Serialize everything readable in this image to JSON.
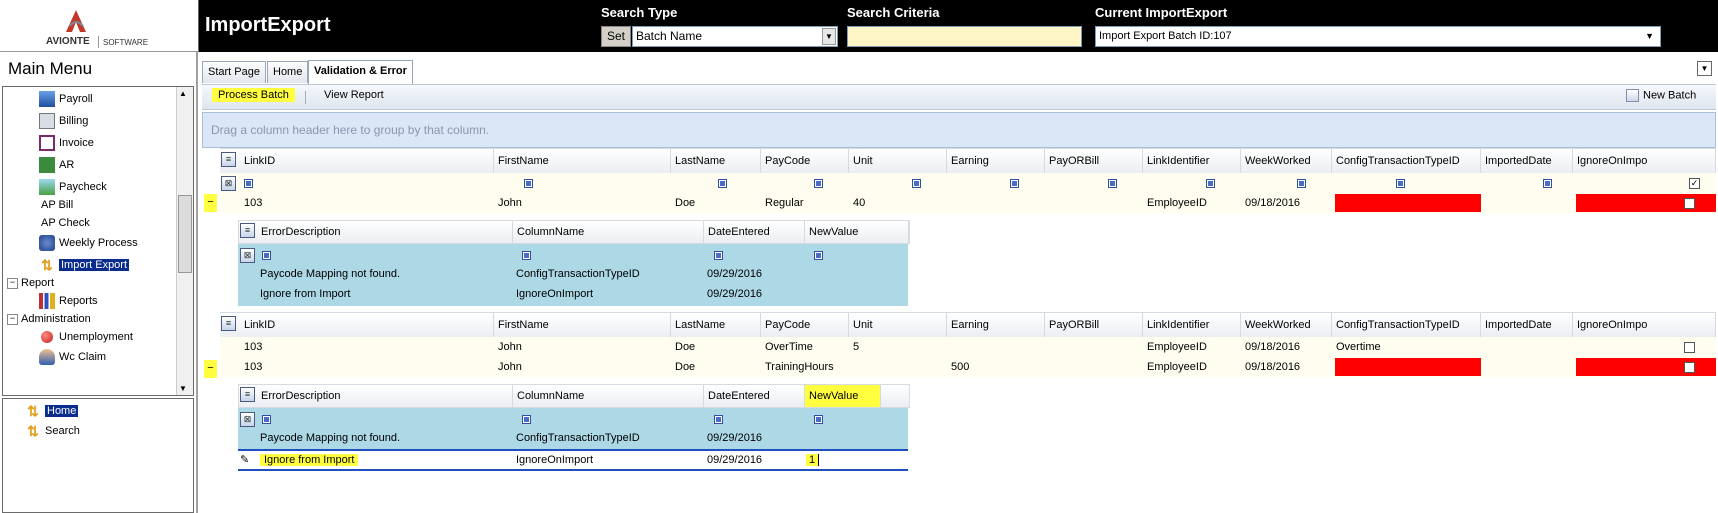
{
  "logo": {
    "brand": "AVIONTE",
    "sub": "SOFTWARE"
  },
  "app_title": "ImportExport",
  "search": {
    "type_label": "Search Type",
    "set_label": "Set",
    "type_value": "Batch Name",
    "criteria_label": "Search Criteria",
    "criteria_value": "",
    "current_label": "Current ImportExport",
    "current_value": "Import Export Batch ID:107"
  },
  "main_menu": {
    "title": "Main Menu",
    "items": [
      {
        "label": "Payroll",
        "icon": "grid-icon"
      },
      {
        "label": "Billing",
        "icon": "list-icon"
      },
      {
        "label": "Invoice",
        "icon": "invoice-icon"
      },
      {
        "label": "AR",
        "icon": "money-icon"
      },
      {
        "label": "Paycheck",
        "icon": "check-icon"
      },
      {
        "label": "AP Bill",
        "icon": ""
      },
      {
        "label": "AP Check",
        "icon": ""
      },
      {
        "label": "Weekly Process",
        "icon": "people-icon"
      },
      {
        "label": "Import Export",
        "icon": "arrows-icon"
      },
      {
        "label": "Report",
        "icon": ""
      },
      {
        "label": "Reports",
        "icon": "chart-icon"
      },
      {
        "label": "Administration",
        "icon": ""
      },
      {
        "label": "Unemployment",
        "icon": "red-dot-icon"
      },
      {
        "label": "Wc Claim",
        "icon": "person-icon"
      }
    ]
  },
  "nav_tree": {
    "home": "Home",
    "search": "Search"
  },
  "tabs": [
    "Start Page",
    "Home",
    "Validation & Error"
  ],
  "toolbar": {
    "process_batch": "Process Batch",
    "view_report": "View Report",
    "new_batch": "New Batch"
  },
  "group_hint": "Drag a column header here to group by that column.",
  "columns": [
    "LinkID",
    "FirstName",
    "LastName",
    "PayCode",
    "Unit",
    "Earning",
    "PayORBill",
    "LinkIdentifier",
    "WeekWorked",
    "ConfigTransactionTypeID",
    "ImportedDate",
    "IgnoreOnImpo"
  ],
  "child_columns": [
    "ErrorDescription",
    "ColumnName",
    "DateEntered",
    "NewValue"
  ],
  "group1": {
    "expander": "−",
    "rows": [
      {
        "LinkID": "103",
        "FirstName": "John",
        "LastName": "Doe",
        "PayCode": "Regular",
        "Unit": "40",
        "Earning": "",
        "PayORBill": "",
        "LinkIdentifier": "EmployeeID",
        "WeekWorked": "09/18/2016",
        "ConfigTransactionTypeID": "",
        "ImportedDate": ""
      }
    ],
    "errors": [
      {
        "ErrorDescription": "Paycode Mapping not found.",
        "ColumnName": "ConfigTransactionTypeID",
        "DateEntered": "09/29/2016",
        "NewValue": ""
      },
      {
        "ErrorDescription": "Ignore from Import",
        "ColumnName": "IgnoreOnImport",
        "DateEntered": "09/29/2016",
        "NewValue": ""
      }
    ]
  },
  "group2": {
    "expander": "−",
    "rows": [
      {
        "LinkID": "103",
        "FirstName": "John",
        "LastName": "Doe",
        "PayCode": "OverTime",
        "Unit": "5",
        "Earning": "",
        "PayORBill": "",
        "LinkIdentifier": "EmployeeID",
        "WeekWorked": "09/18/2016",
        "ConfigTransactionTypeID": "Overtime",
        "ImportedDate": ""
      },
      {
        "LinkID": "103",
        "FirstName": "John",
        "LastName": "Doe",
        "PayCode": "TrainingHours",
        "Unit": "",
        "Earning": "500",
        "PayORBill": "",
        "LinkIdentifier": "EmployeeID",
        "WeekWorked": "09/18/2016",
        "ConfigTransactionTypeID": "",
        "ImportedDate": ""
      }
    ],
    "errors": [
      {
        "ErrorDescription": "Paycode Mapping not found.",
        "ColumnName": "ConfigTransactionTypeID",
        "DateEntered": "09/29/2016",
        "NewValue": ""
      },
      {
        "ErrorDescription": "Ignore from Import",
        "ColumnName": "IgnoreOnImport",
        "DateEntered": "09/29/2016",
        "NewValue": "1"
      }
    ]
  },
  "colors": {
    "highlight": "#ffff40",
    "error_cell": "#ff0000",
    "error_row": "#add8e6",
    "selected": "#0a2c8c"
  }
}
